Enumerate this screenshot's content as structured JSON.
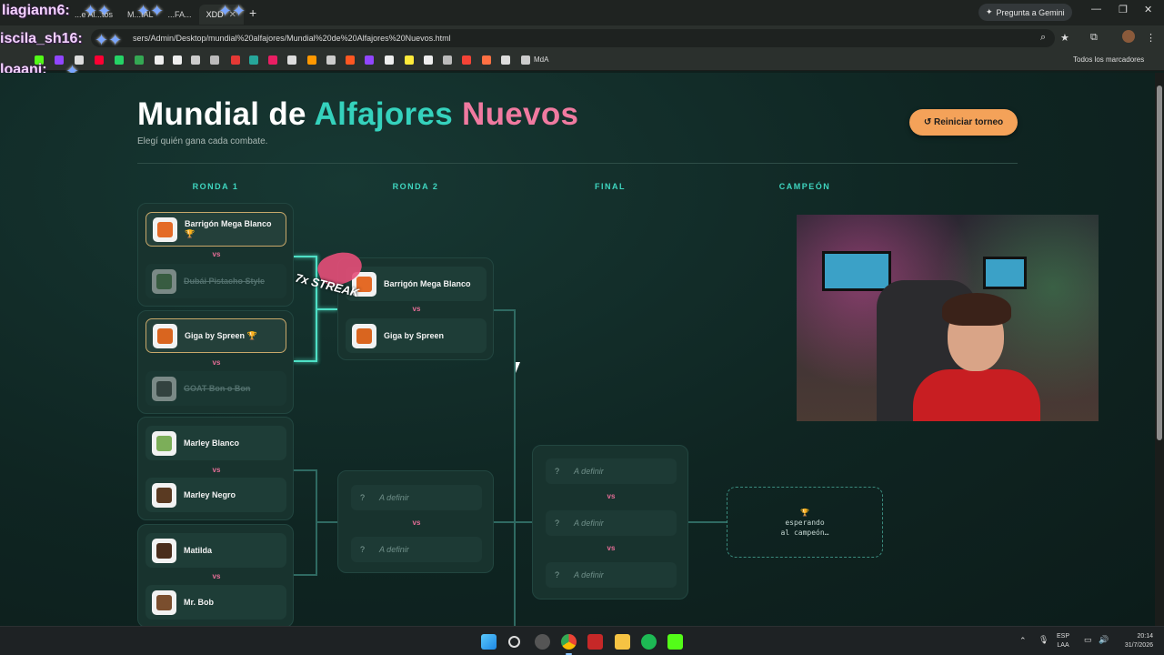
{
  "browser": {
    "tabs": [
      {
        "label": "...e Al...tos"
      },
      {
        "label": "M...IAL"
      },
      {
        "label": "...FA..."
      },
      {
        "label": "XDD"
      }
    ],
    "gemini_label": "Pregunta a Gemini",
    "url": "sers/Admin/Desktop/mundial%20alfajores/Mundial%20de%20Alfajores%20Nuevos.html",
    "bookmark_mda": "MdA",
    "bookmark_all": "Todos los marcadores"
  },
  "overlay": {
    "users": [
      "liagiann6:",
      "iscila_sh16:",
      "loaani:"
    ]
  },
  "page": {
    "title_part1": "Mundial de",
    "title_part2": "Alfajores",
    "title_part3": "Nuevos",
    "subtitle": "Elegí quién gana cada combate.",
    "reset_label": "↺ Reiniciar torneo",
    "columns": [
      "RONDA 1",
      "RONDA 2",
      "FINAL",
      "CAMPEÓN"
    ],
    "vs_label": "vs",
    "tbd_label": "A definir",
    "tbd_mark": "?",
    "champion_icon": "trophy-icon",
    "champion_text_line1": "esperando",
    "champion_text_line2": "al campeón…",
    "streak_label": "7x STREAK"
  },
  "round1": [
    {
      "a": "Barrigón Mega Blanco",
      "a_badge": "🏆",
      "b": "Dubái Pistacho Style",
      "winner": "a"
    },
    {
      "a": "Giga by Spreen",
      "a_badge": "🏆",
      "b": "GOAT Bon o Bon",
      "winner": "a"
    },
    {
      "a": "Marley Blanco",
      "b": "Marley Negro",
      "winner": null
    },
    {
      "a": "Matilda",
      "b": "Mr. Bob",
      "winner": null
    }
  ],
  "round2": [
    {
      "a": "Barrigón Mega Blanco",
      "b": "Giga by Spreen"
    }
  ],
  "taskbar": {
    "lang_line1": "ESP",
    "lang_line2": "LAA",
    "time": "20:14",
    "date": "31/7/2026"
  },
  "colors": {
    "accent_teal": "#35d2bd",
    "accent_pink": "#f07aa0",
    "reset_orange": "#f4a259",
    "winner_border": "#c8a86a"
  }
}
